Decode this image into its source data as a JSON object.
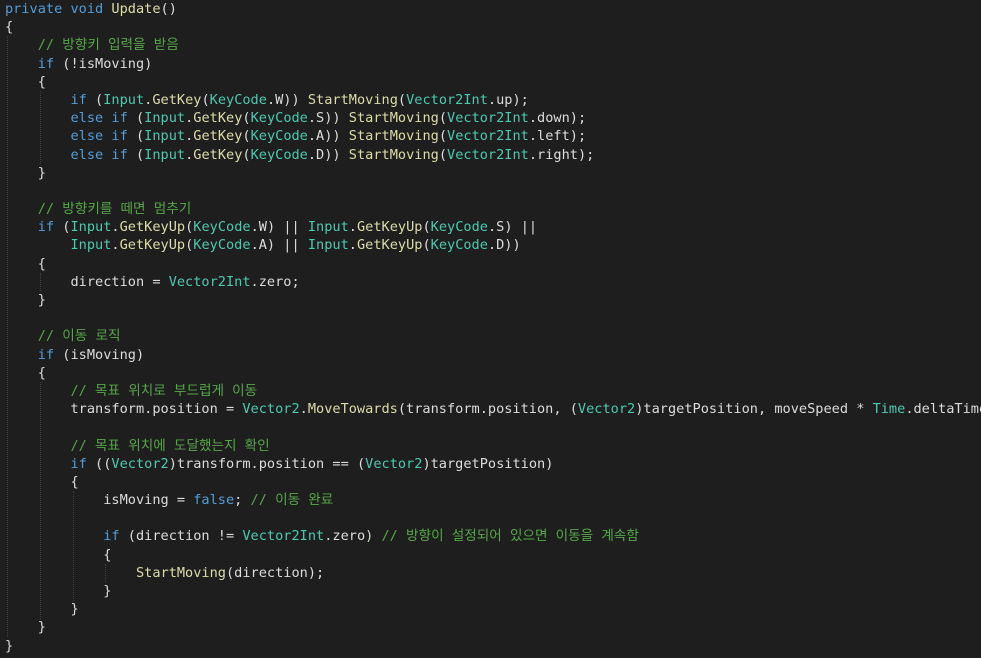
{
  "editor": {
    "colors": {
      "background": "#1e1e1e",
      "keyword": "#569cd6",
      "type": "#4ec9b0",
      "method": "#dcdcaa",
      "comment": "#57a64a",
      "plain": "#dcdcdc"
    },
    "lines": [
      [
        [
          "kw",
          "private"
        ],
        [
          "pl",
          " "
        ],
        [
          "kw",
          "void"
        ],
        [
          "pl",
          " "
        ],
        [
          "fn",
          "Update"
        ],
        [
          "pl",
          "()"
        ]
      ],
      [
        [
          "pl",
          "{"
        ]
      ],
      [
        [
          "pl",
          "    "
        ],
        [
          "cm",
          "// 방향키 입력을 받음"
        ]
      ],
      [
        [
          "pl",
          "    "
        ],
        [
          "kw",
          "if"
        ],
        [
          "pl",
          " (!isMoving)"
        ]
      ],
      [
        [
          "pl",
          "    {"
        ]
      ],
      [
        [
          "pl",
          "        "
        ],
        [
          "kw",
          "if"
        ],
        [
          "pl",
          " ("
        ],
        [
          "ty",
          "Input"
        ],
        [
          "pl",
          "."
        ],
        [
          "fn",
          "GetKey"
        ],
        [
          "pl",
          "("
        ],
        [
          "ty",
          "KeyCode"
        ],
        [
          "pl",
          ".W)) "
        ],
        [
          "fn",
          "StartMoving"
        ],
        [
          "pl",
          "("
        ],
        [
          "ty",
          "Vector2Int"
        ],
        [
          "pl",
          ".up);"
        ]
      ],
      [
        [
          "pl",
          "        "
        ],
        [
          "kw",
          "else"
        ],
        [
          "pl",
          " "
        ],
        [
          "kw",
          "if"
        ],
        [
          "pl",
          " ("
        ],
        [
          "ty",
          "Input"
        ],
        [
          "pl",
          "."
        ],
        [
          "fn",
          "GetKey"
        ],
        [
          "pl",
          "("
        ],
        [
          "ty",
          "KeyCode"
        ],
        [
          "pl",
          ".S)) "
        ],
        [
          "fn",
          "StartMoving"
        ],
        [
          "pl",
          "("
        ],
        [
          "ty",
          "Vector2Int"
        ],
        [
          "pl",
          ".down);"
        ]
      ],
      [
        [
          "pl",
          "        "
        ],
        [
          "kw",
          "else"
        ],
        [
          "pl",
          " "
        ],
        [
          "kw",
          "if"
        ],
        [
          "pl",
          " ("
        ],
        [
          "ty",
          "Input"
        ],
        [
          "pl",
          "."
        ],
        [
          "fn",
          "GetKey"
        ],
        [
          "pl",
          "("
        ],
        [
          "ty",
          "KeyCode"
        ],
        [
          "pl",
          ".A)) "
        ],
        [
          "fn",
          "StartMoving"
        ],
        [
          "pl",
          "("
        ],
        [
          "ty",
          "Vector2Int"
        ],
        [
          "pl",
          ".left);"
        ]
      ],
      [
        [
          "pl",
          "        "
        ],
        [
          "kw",
          "else"
        ],
        [
          "pl",
          " "
        ],
        [
          "kw",
          "if"
        ],
        [
          "pl",
          " ("
        ],
        [
          "ty",
          "Input"
        ],
        [
          "pl",
          "."
        ],
        [
          "fn",
          "GetKey"
        ],
        [
          "pl",
          "("
        ],
        [
          "ty",
          "KeyCode"
        ],
        [
          "pl",
          ".D)) "
        ],
        [
          "fn",
          "StartMoving"
        ],
        [
          "pl",
          "("
        ],
        [
          "ty",
          "Vector2Int"
        ],
        [
          "pl",
          ".right);"
        ]
      ],
      [
        [
          "pl",
          "    }"
        ]
      ],
      [],
      [
        [
          "pl",
          "    "
        ],
        [
          "cm",
          "// 방향키를 떼면 멈추기"
        ]
      ],
      [
        [
          "pl",
          "    "
        ],
        [
          "kw",
          "if"
        ],
        [
          "pl",
          " ("
        ],
        [
          "ty",
          "Input"
        ],
        [
          "pl",
          "."
        ],
        [
          "fn",
          "GetKeyUp"
        ],
        [
          "pl",
          "("
        ],
        [
          "ty",
          "KeyCode"
        ],
        [
          "pl",
          ".W) || "
        ],
        [
          "ty",
          "Input"
        ],
        [
          "pl",
          "."
        ],
        [
          "fn",
          "GetKeyUp"
        ],
        [
          "pl",
          "("
        ],
        [
          "ty",
          "KeyCode"
        ],
        [
          "pl",
          ".S) ||"
        ]
      ],
      [
        [
          "pl",
          "        "
        ],
        [
          "ty",
          "Input"
        ],
        [
          "pl",
          "."
        ],
        [
          "fn",
          "GetKeyUp"
        ],
        [
          "pl",
          "("
        ],
        [
          "ty",
          "KeyCode"
        ],
        [
          "pl",
          ".A) || "
        ],
        [
          "ty",
          "Input"
        ],
        [
          "pl",
          "."
        ],
        [
          "fn",
          "GetKeyUp"
        ],
        [
          "pl",
          "("
        ],
        [
          "ty",
          "KeyCode"
        ],
        [
          "pl",
          ".D))"
        ]
      ],
      [
        [
          "pl",
          "    {"
        ]
      ],
      [
        [
          "pl",
          "        direction = "
        ],
        [
          "ty",
          "Vector2Int"
        ],
        [
          "pl",
          ".zero;"
        ]
      ],
      [
        [
          "pl",
          "    }"
        ]
      ],
      [],
      [
        [
          "pl",
          "    "
        ],
        [
          "cm",
          "// 이동 로직"
        ]
      ],
      [
        [
          "pl",
          "    "
        ],
        [
          "kw",
          "if"
        ],
        [
          "pl",
          " (isMoving)"
        ]
      ],
      [
        [
          "pl",
          "    {"
        ]
      ],
      [
        [
          "pl",
          "        "
        ],
        [
          "cm",
          "// 목표 위치로 부드럽게 이동"
        ]
      ],
      [
        [
          "pl",
          "        transform.position = "
        ],
        [
          "ty",
          "Vector2"
        ],
        [
          "pl",
          "."
        ],
        [
          "fn",
          "MoveTowards"
        ],
        [
          "pl",
          "(transform.position, ("
        ],
        [
          "ty",
          "Vector2"
        ],
        [
          "pl",
          ")targetPosition, moveSpeed * "
        ],
        [
          "ty",
          "Time"
        ],
        [
          "pl",
          ".deltaTime);"
        ]
      ],
      [],
      [
        [
          "pl",
          "        "
        ],
        [
          "cm",
          "// 목표 위치에 도달했는지 확인"
        ]
      ],
      [
        [
          "pl",
          "        "
        ],
        [
          "kw",
          "if"
        ],
        [
          "pl",
          " (("
        ],
        [
          "ty",
          "Vector2"
        ],
        [
          "pl",
          ")transform.position == ("
        ],
        [
          "ty",
          "Vector2"
        ],
        [
          "pl",
          ")targetPosition)"
        ]
      ],
      [
        [
          "pl",
          "        {"
        ]
      ],
      [
        [
          "pl",
          "            isMoving = "
        ],
        [
          "kw",
          "false"
        ],
        [
          "pl",
          "; "
        ],
        [
          "cm",
          "// 이동 완료"
        ]
      ],
      [],
      [
        [
          "pl",
          "            "
        ],
        [
          "kw",
          "if"
        ],
        [
          "pl",
          " (direction != "
        ],
        [
          "ty",
          "Vector2Int"
        ],
        [
          "pl",
          ".zero) "
        ],
        [
          "cm",
          "// 방향이 설정되어 있으면 이동을 계속함"
        ]
      ],
      [
        [
          "pl",
          "            {"
        ]
      ],
      [
        [
          "pl",
          "                "
        ],
        [
          "fn",
          "StartMoving"
        ],
        [
          "pl",
          "(direction);"
        ]
      ],
      [
        [
          "pl",
          "            }"
        ]
      ],
      [
        [
          "pl",
          "        }"
        ]
      ],
      [
        [
          "pl",
          "    }"
        ]
      ],
      [
        [
          "pl",
          "}"
        ]
      ]
    ]
  }
}
